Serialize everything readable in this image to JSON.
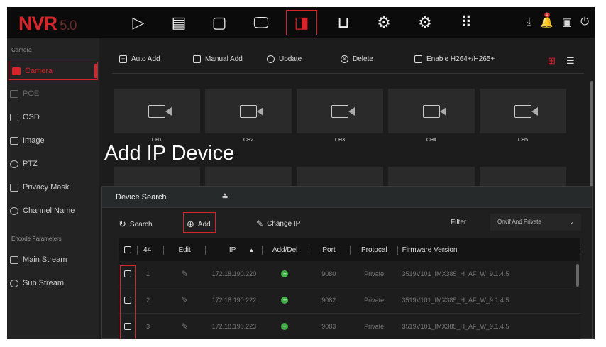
{
  "header": {
    "logo": "NVR",
    "version": "5.0",
    "nav": [
      {
        "icon": "play-icon",
        "g": "▷"
      },
      {
        "icon": "playback-film-icon",
        "g": "▤"
      },
      {
        "icon": "folder-icon",
        "g": "🗀"
      },
      {
        "icon": "monitor-icon",
        "g": "🖵"
      },
      {
        "icon": "camera-icon",
        "g": "▭◁"
      },
      {
        "icon": "tray-icon",
        "g": "⊔"
      },
      {
        "icon": "gear-icon",
        "g": "⚙"
      },
      {
        "icon": "settings-advanced-icon",
        "g": "⚙"
      },
      {
        "icon": "apps-grid-icon",
        "g": "⠿"
      }
    ],
    "badge": "1"
  },
  "sidebar": {
    "section1": "Camera",
    "items": [
      {
        "label": "Camera"
      },
      {
        "label": "POE"
      },
      {
        "label": "OSD"
      },
      {
        "label": "Image"
      },
      {
        "label": "PTZ"
      },
      {
        "label": "Privacy Mask"
      },
      {
        "label": "Channel Name"
      }
    ],
    "section2": "Encode Parameters",
    "items2": [
      {
        "label": "Main Stream"
      },
      {
        "label": "Sub Stream"
      }
    ]
  },
  "toolbar": {
    "auto_add": "Auto Add",
    "manual_add": "Manual Add",
    "update": "Update",
    "delete": "Delete",
    "enable": "Enable H264+/H265+"
  },
  "channels": [
    "CH1",
    "CH2",
    "CH3",
    "CH4",
    "CH5"
  ],
  "overlay_title": "Add IP Device",
  "panel": {
    "title": "Device Search",
    "search": "Search",
    "add": "Add",
    "change_ip": "Change IP",
    "filter_label": "Filter",
    "filter_value": "Onvif And Private",
    "columns": {
      "count": "44",
      "edit": "Edit",
      "ip": "IP",
      "adddel": "Add/Del",
      "port": "Port",
      "protocol": "Protocal",
      "firmware": "Firmware Version"
    },
    "rows": [
      {
        "no": "1",
        "ip": "172.18.190.220",
        "port": "9080",
        "protocol": "Private",
        "firmware": "3519V101_IMX385_H_AF_W_9.1.4.5"
      },
      {
        "no": "2",
        "ip": "172.18.190.222",
        "port": "9082",
        "protocol": "Private",
        "firmware": "3519V101_IMX385_H_AF_W_9.1.4.5"
      },
      {
        "no": "3",
        "ip": "172.18.190.223",
        "port": "9083",
        "protocol": "Private",
        "firmware": "3519V101_IMX385_H_AF_W_9.1.4.5"
      }
    ]
  }
}
